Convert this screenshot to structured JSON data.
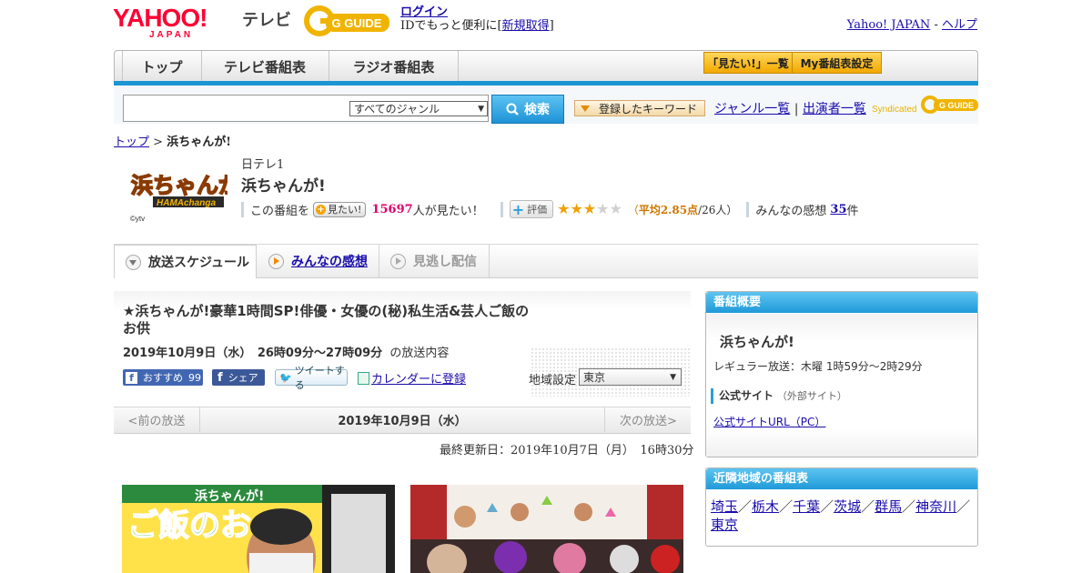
{
  "header": {
    "logo_text": "YAHOO!",
    "logo_sub": "JAPAN",
    "section": "テレビ",
    "gguide_logo": "G GUIDE",
    "login": "ログイン",
    "login_prompt_pre": "IDでもっと便利に[",
    "signup": "新規取得",
    "login_prompt_post": "]",
    "yahoo_japan": "Yahoo! JAPAN",
    "separator": "-",
    "help": "ヘルプ"
  },
  "nav": {
    "tabs": [
      "トップ",
      "テレビ番組表",
      "ラジオ番組表"
    ],
    "want_list": "「見たい!」一覧",
    "my_schedule": "My番組表設定"
  },
  "search": {
    "input_value": "",
    "genre": "すべてのジャンル",
    "button": "検索",
    "keywords": "登録したキーワード",
    "genre_list": "ジャンル一覧",
    "divider": "|",
    "performers": "出演者一覧",
    "syndicated": "Syndicated",
    "syndicated_logo": "G GUIDE"
  },
  "breadcrumb": {
    "top": "トップ",
    "sep": ">",
    "current": "浜ちゃんが!"
  },
  "program": {
    "logo_text": "浜ちゃんが!",
    "logo_sub": "HAMAchanga",
    "copyright": "©ytv",
    "channel": "日テレ1",
    "title": "浜ちゃんが!",
    "want_pre": "この番組を",
    "want_btn": "見たい!",
    "want_count": "15697",
    "want_post": "人が見たい！",
    "rate_btn": "評価",
    "rating": 2.85,
    "rating_paren_open": "（",
    "rating_avg_label": "平均2.85点",
    "rating_count": "/26人）",
    "impressions_pre": "みんなの感想",
    "impressions_count": "35",
    "impressions_post": "件"
  },
  "tabs": {
    "schedule": "放送スケジュール",
    "impressions": "みんなの感想",
    "missed": "見逃し配信"
  },
  "episode": {
    "title": "★浜ちゃんが!豪華1時間SP!俳優・女優の(秘)私生活&芸人ご飯のお供",
    "date": "2019年10月9日（水）　26時09分～27時09分",
    "date_suffix": "の放送内容",
    "fb_recommend": "おすすめ",
    "fb_recommend_count": "99",
    "fb_share": "シェア",
    "tweet": "ツイートする",
    "calendar": "カレンダーに登録",
    "region_label": "地域設定",
    "region_value": "東京",
    "prev": "<前の放送",
    "current_date": "2019年10月9日（水）",
    "next": "次の放送>",
    "updated": "最終更新日：2019年10月7日（月）　16時30分",
    "thumb1_text": "ご飯のお",
    "thumb1_logo": "浜ちゃんが!"
  },
  "sidebar": {
    "overview_head": "番組概要",
    "overview_title": "浜ちゃんが!",
    "regular": "レギュラー放送：木曜 1時59分～2時29分",
    "official": "公式サイト",
    "official_ext": "（外部サイト）",
    "official_url": "公式サイトURL（PC）",
    "nearby_head": "近隣地域の番組表",
    "regions": [
      "埼玉",
      "栃木",
      "千葉",
      "茨城",
      "群馬",
      "神奈川",
      "東京"
    ],
    "region_sep": "／"
  },
  "colors": {
    "accent_blue": "#1b95d3",
    "brand_red": "#ff0033",
    "star": "#f0a000",
    "want_count": "#e0006c",
    "rating_avg": "#cc7700"
  }
}
